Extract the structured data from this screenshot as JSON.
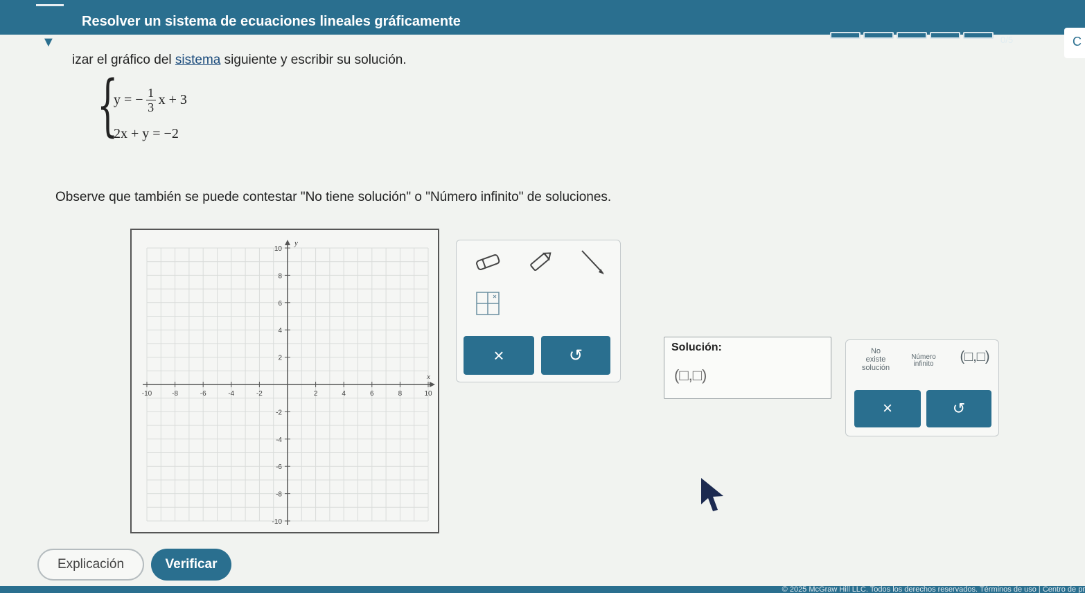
{
  "header": {
    "title": "Resolver un sistema de ecuaciones lineales gráficamente",
    "progress_label": "0/5",
    "progress_segments": 5,
    "progress_completed": 0,
    "corner_button_label": "C"
  },
  "problem": {
    "instruction_start": "izar el gráfico del ",
    "instruction_link": "sistema",
    "instruction_end": " siguiente y escribir su solución.",
    "equation1_lhs": "y = −",
    "equation1_num": "1",
    "equation1_den": "3",
    "equation1_rhs": "x + 3",
    "equation2": "2x + y = −2",
    "note": "Observe que también se puede contestar \"No tiene solución\" o \"Número infinito\" de soluciones."
  },
  "graph": {
    "xmin": -10,
    "xmax": 10,
    "ymin": -10,
    "ymax": 10,
    "x_axis_label": "x",
    "y_axis_label": "y",
    "x_tick_labels": [
      "-10",
      "-8",
      "-6",
      "-4",
      "-2",
      "2",
      "4",
      "6",
      "8",
      "10"
    ],
    "y_tick_labels": [
      "10",
      "8",
      "6",
      "4",
      "2",
      "-2",
      "-4",
      "-6",
      "-8",
      "-10"
    ]
  },
  "tools": {
    "eraser_icon": "eraser-icon",
    "pencil_icon": "pencil-icon",
    "line_icon": "line-icon",
    "grid_icon": "graph-grid-icon",
    "clear_label": "×",
    "undo_label": "↺"
  },
  "solution": {
    "label": "Solución:",
    "pair_template": "(□,□)",
    "option_no_solution_line1": "No",
    "option_no_solution_line2": "existe",
    "option_no_solution_line3": "solución",
    "option_infinite_line1": "Número",
    "option_infinite_line2": "infinito",
    "option_pair": "(□,□)",
    "clear_label": "×",
    "undo_label": "↺"
  },
  "bottom": {
    "explanation_label": "Explicación",
    "check_label": "Verificar"
  },
  "footer": {
    "text": "© 2025 McGraw Hill LLC. Todos los derechos reservados.   Términos de uso  |  Centro de pr"
  },
  "colors": {
    "brand": "#2a6f8f",
    "link": "#1b4b7c"
  }
}
